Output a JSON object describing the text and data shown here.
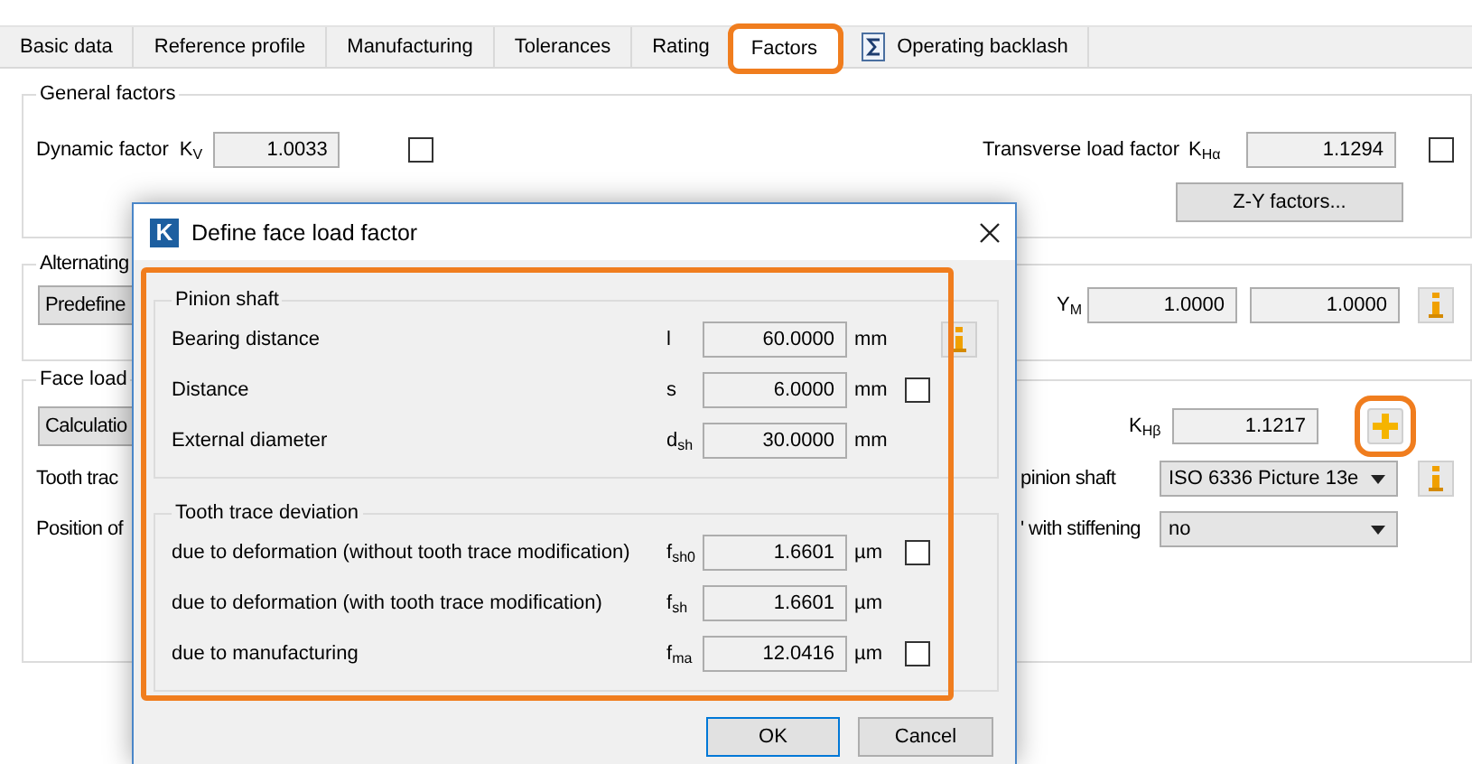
{
  "tabs": [
    {
      "label": "Basic data",
      "selected": false,
      "highlighted": false,
      "kind": "text"
    },
    {
      "label": "Reference profile",
      "selected": false,
      "highlighted": false,
      "kind": "text"
    },
    {
      "label": "Manufacturing",
      "selected": false,
      "highlighted": false,
      "kind": "text"
    },
    {
      "label": "Tolerances",
      "selected": false,
      "highlighted": false,
      "kind": "text"
    },
    {
      "label": "Rating",
      "selected": false,
      "highlighted": false,
      "kind": "text"
    },
    {
      "label": "Factors",
      "selected": true,
      "highlighted": true,
      "kind": "text"
    },
    {
      "label": "Operating backlash",
      "selected": false,
      "highlighted": false,
      "kind": "icon"
    }
  ],
  "general_factors": {
    "title": "General factors",
    "dynamic_factor": {
      "label": "Dynamic factor",
      "symbol": "K$_{V}$",
      "value": "1.0033",
      "checked": false
    },
    "transverse_load_factor": {
      "label": "Transverse load factor",
      "symbol": "K$_{Hα}$",
      "value": "1.1294",
      "checked": false
    },
    "zy_button": "Z-Y factors..."
  },
  "alternating": {
    "title": "Alternating",
    "mode_button": "Predefine",
    "symbol": "Y$_{M}$",
    "values": [
      "1.0000",
      "1.0000"
    ]
  },
  "face_load": {
    "title": "Face load",
    "mode_button": "Calculatio",
    "symbol": "K$_{Hβ}$",
    "value": "1.1217",
    "plus_highlighted": true,
    "rows": [
      {
        "label": "Tooth trac",
        "right_label": "pinion shaft",
        "combo": "ISO 6336 Picture 13e",
        "info": true
      },
      {
        "label": "Position of",
        "right_label": "' with stiffening",
        "combo": "no",
        "info": false
      }
    ]
  },
  "dialog": {
    "logo": "K",
    "title": "Define face load factor",
    "highlighted": true,
    "groups": [
      {
        "title": "Pinion shaft",
        "info_button": true,
        "rows": [
          {
            "label": "Bearing distance",
            "symbol": "l",
            "value": "60.0000",
            "unit": "mm"
          },
          {
            "label": "Distance",
            "symbol": "s",
            "value": "6.0000",
            "unit": "mm",
            "checked": false
          },
          {
            "label": "External diameter",
            "symbol": "d$_{sh}$",
            "value": "30.0000",
            "unit": "mm"
          }
        ]
      },
      {
        "title": "Tooth trace deviation",
        "info_button": false,
        "rows": [
          {
            "label": "due to deformation (without tooth trace modification)",
            "symbol": "f$_{sh0}$",
            "value": "1.6601",
            "unit": "µm",
            "checked": false
          },
          {
            "label": "due to deformation (with tooth trace modification)",
            "symbol": "f$_{sh}$",
            "value": "1.6601",
            "unit": "µm"
          },
          {
            "label": "due to manufacturing",
            "symbol": "f$_{ma}$",
            "value": "12.0416",
            "unit": "µm",
            "checked": false
          }
        ]
      }
    ],
    "buttons": [
      {
        "label": "OK",
        "default": true
      },
      {
        "label": "Cancel",
        "default": false
      }
    ]
  }
}
